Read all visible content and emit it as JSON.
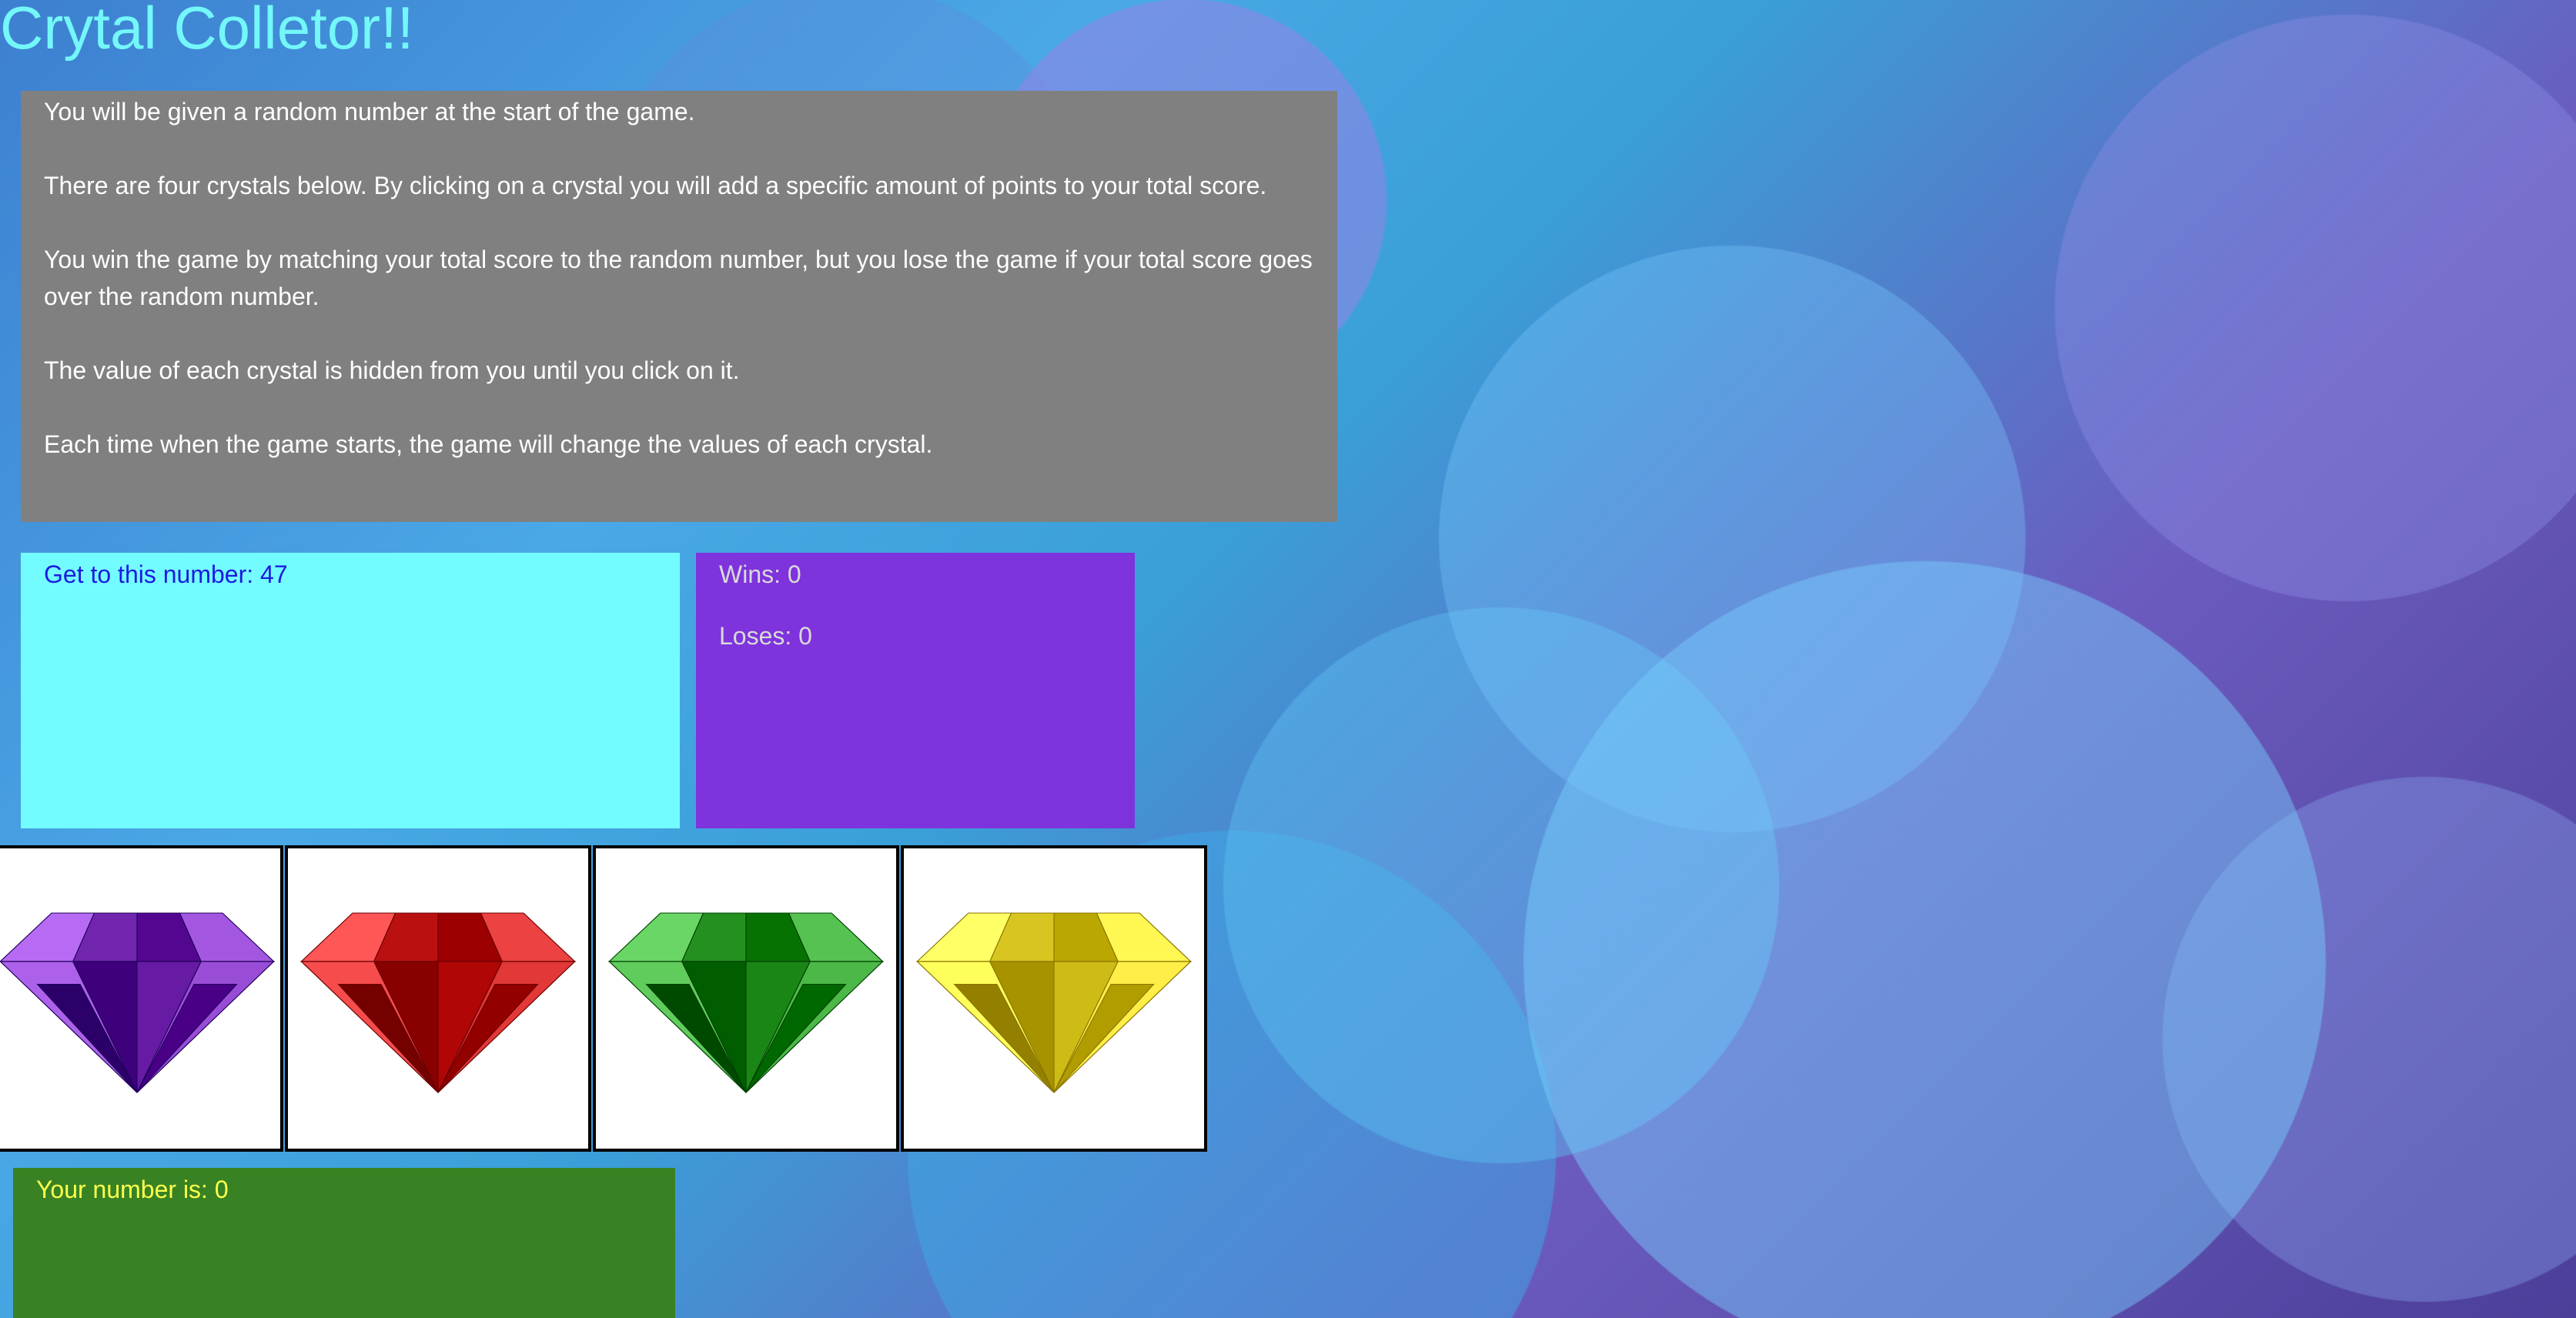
{
  "title": "Crytal Colletor!!",
  "instructions": [
    "You will be given a random number at the start of the game.",
    "There are four crystals below. By clicking on a crystal you will add a specific amount of points to your total score.",
    "You win the game by matching your total score to the random number, but you lose the game if your total score goes over the random number.",
    "The value of each crystal is hidden from you until you click on it.",
    "Each time when the game starts, the game will change the values of each crystal."
  ],
  "target": {
    "text": "Get to this number: 47"
  },
  "score": {
    "wins_text": "Wins: 0",
    "losses_text": "Loses: 0"
  },
  "crystals": [
    {
      "icon": "purple-crystal-icon",
      "color": "#7b2fb8"
    },
    {
      "icon": "red-crystal-icon",
      "color": "#c41a1a"
    },
    {
      "icon": "green-crystal-icon",
      "color": "#2e9a2a"
    },
    {
      "icon": "yellow-crystal-icon",
      "color": "#e3cf2a"
    }
  ],
  "player": {
    "text": "Your number is: 0"
  },
  "colors": {
    "title": "#73f7f9",
    "instructions_bg": "#808080",
    "target_bg": "#73fcff",
    "target_text": "#1b1be0",
    "score_bg": "#7e33dc",
    "player_bg": "#388223",
    "player_text": "#ffff4d"
  }
}
